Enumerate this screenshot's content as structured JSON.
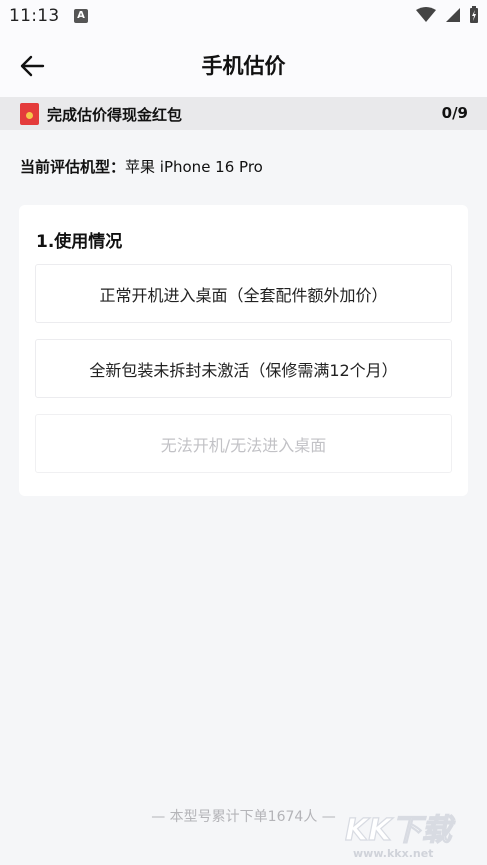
{
  "status_bar": {
    "time": "11:13",
    "badge": "A",
    "icons": [
      "wifi-icon",
      "signal-icon",
      "battery-charging-icon"
    ]
  },
  "nav": {
    "title": "手机估价",
    "back_icon": "arrow-left-icon"
  },
  "reward_banner": {
    "icon": "red-packet-icon",
    "text": "完成估价得现金红包",
    "progress": "0/9"
  },
  "model": {
    "label": "当前评估机型：",
    "value": "苹果 iPhone 16 Pro"
  },
  "section": {
    "title": "1.使用情况",
    "options": [
      {
        "label": "正常开机进入桌面（全套配件额外加价）",
        "enabled": true
      },
      {
        "label": "全新包装未拆封未激活（保修需满12个月）",
        "enabled": true
      },
      {
        "label": "无法开机/无法进入桌面",
        "enabled": false
      }
    ]
  },
  "footer": {
    "note": "— 本型号累计下单1674人 —"
  },
  "watermark": {
    "logo": "KK下载",
    "url": "www.kkx.net"
  },
  "colors": {
    "background": "#f5f6f8",
    "card": "#ffffff",
    "banner": "#e9e9eb",
    "red_packet": "#e43b3b",
    "disabled_text": "#c2c2c6"
  }
}
